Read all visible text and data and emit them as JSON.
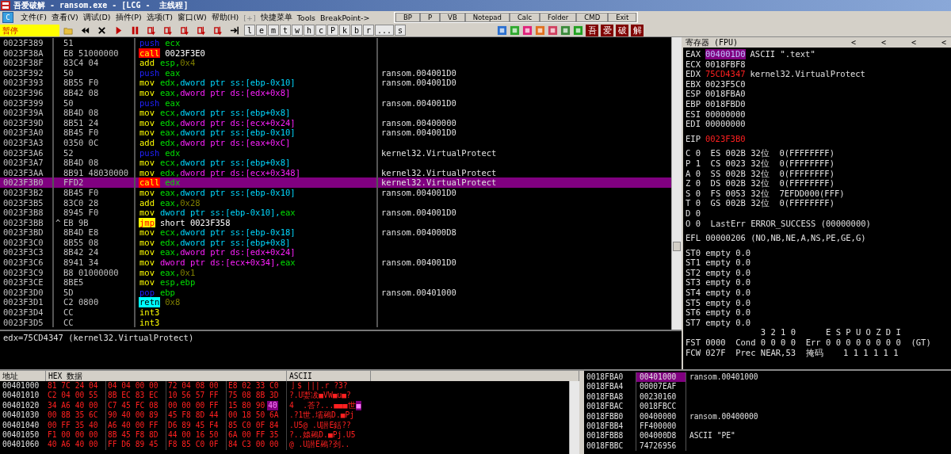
{
  "window": {
    "title": "吾爱破解 - ransom.exe - [LCG -  主线程]"
  },
  "menu": {
    "logo": "C",
    "items": [
      {
        "label": "文件(F)",
        "disabled": false
      },
      {
        "label": "查看(V)",
        "disabled": false
      },
      {
        "label": "调试(D)",
        "disabled": false
      },
      {
        "label": "插件(P)",
        "disabled": false
      },
      {
        "label": "选项(T)",
        "disabled": false
      },
      {
        "label": "窗口(W)",
        "disabled": false
      },
      {
        "label": "帮助(H)",
        "disabled": false
      },
      {
        "label": "[+]",
        "disabled": true
      },
      {
        "label": "快捷菜单",
        "disabled": false
      },
      {
        "label": "Tools",
        "disabled": false
      },
      {
        "label": "BreakPoint->",
        "disabled": false
      }
    ]
  },
  "quick_buttons": [
    "BP",
    "P",
    "VB",
    "Notepad",
    "Calc",
    "Folder",
    "CMD",
    "Exit"
  ],
  "toolbar": {
    "status": "暂停",
    "letter_buttons": [
      "l",
      "e",
      "m",
      "t",
      "w",
      "h",
      "c",
      "P",
      "k",
      "b",
      "r",
      "...",
      "s"
    ],
    "logo_buttons": [
      "吾",
      "爱",
      "破",
      "解"
    ]
  },
  "disasm": {
    "rows": [
      {
        "addr": "0023F389",
        "hex": "51",
        "kind": "stack",
        "mnem": "push",
        "ops": [
          {
            "text": "ecx",
            "kind": "reg"
          }
        ],
        "selected": false
      },
      {
        "addr": "0023F38A",
        "hex": "E8 51000000",
        "kind": "call",
        "mnem": "call",
        "ops": [
          {
            "text": "0023F3E0",
            "kind": "addr"
          }
        ],
        "selected": false
      },
      {
        "addr": "0023F38F",
        "hex": "83C4 04",
        "kind": "plain",
        "mnem": "add",
        "ops": [
          {
            "text": "esp,",
            "kind": "reg"
          },
          {
            "text": "0x4",
            "kind": "imm"
          }
        ],
        "selected": false
      },
      {
        "addr": "0023F392",
        "hex": "50",
        "kind": "stack",
        "mnem": "push",
        "ops": [
          {
            "text": "eax",
            "kind": "reg"
          }
        ],
        "comment": "ransom.004001D0",
        "selected": false
      },
      {
        "addr": "0023F393",
        "hex": "8B55 F0",
        "kind": "plain",
        "mnem": "mov",
        "ops": [
          {
            "text": "edx,",
            "kind": "reg"
          },
          {
            "text": "dword ptr ss:[ebp-0x10]",
            "kind": "ss"
          }
        ],
        "comment": "ransom.004001D0",
        "selected": false
      },
      {
        "addr": "0023F396",
        "hex": "8B42 08",
        "kind": "plain",
        "mnem": "mov",
        "ops": [
          {
            "text": "eax,",
            "kind": "reg"
          },
          {
            "text": "dword ptr ds:[edx+0x8]",
            "kind": "ds"
          }
        ],
        "selected": false
      },
      {
        "addr": "0023F399",
        "hex": "50",
        "kind": "stack",
        "mnem": "push",
        "ops": [
          {
            "text": "eax",
            "kind": "reg"
          }
        ],
        "comment": "ransom.004001D0",
        "selected": false
      },
      {
        "addr": "0023F39A",
        "hex": "8B4D 08",
        "kind": "plain",
        "mnem": "mov",
        "ops": [
          {
            "text": "ecx,",
            "kind": "reg"
          },
          {
            "text": "dword ptr ss:[ebp+0x8]",
            "kind": "ss"
          }
        ],
        "selected": false
      },
      {
        "addr": "0023F39D",
        "hex": "8B51 24",
        "kind": "plain",
        "mnem": "mov",
        "ops": [
          {
            "text": "edx,",
            "kind": "reg"
          },
          {
            "text": "dword ptr ds:[ecx+0x24]",
            "kind": "ds"
          }
        ],
        "comment": "ransom.00400000",
        "selected": false
      },
      {
        "addr": "0023F3A0",
        "hex": "8B45 F0",
        "kind": "plain",
        "mnem": "mov",
        "ops": [
          {
            "text": "eax,",
            "kind": "reg"
          },
          {
            "text": "dword ptr ss:[ebp-0x10]",
            "kind": "ss"
          }
        ],
        "comment": "ransom.004001D0",
        "selected": false
      },
      {
        "addr": "0023F3A3",
        "hex": "0350 0C",
        "kind": "plain",
        "mnem": "add",
        "ops": [
          {
            "text": "edx,",
            "kind": "reg"
          },
          {
            "text": "dword ptr ds:[eax+0xC]",
            "kind": "ds"
          }
        ],
        "selected": false
      },
      {
        "addr": "0023F3A6",
        "hex": "52",
        "kind": "stack",
        "mnem": "push",
        "ops": [
          {
            "text": "edx",
            "kind": "reg"
          }
        ],
        "comment": "kernel32.VirtualProtect",
        "selected": false
      },
      {
        "addr": "0023F3A7",
        "hex": "8B4D 08",
        "kind": "plain",
        "mnem": "mov",
        "ops": [
          {
            "text": "ecx,",
            "kind": "reg"
          },
          {
            "text": "dword ptr ss:[ebp+0x8]",
            "kind": "ss"
          }
        ],
        "selected": false
      },
      {
        "addr": "0023F3AA",
        "hex": "8B91 48030000",
        "kind": "plain",
        "mnem": "mov",
        "ops": [
          {
            "text": "edx,",
            "kind": "reg"
          },
          {
            "text": "dword ptr ds:[ecx+0x348]",
            "kind": "ds"
          }
        ],
        "comment": "kernel32.VirtualProtect",
        "selected": false
      },
      {
        "addr": "0023F3B0",
        "hex": "FFD2",
        "kind": "call",
        "mnem": "call",
        "ops": [
          {
            "text": "edx",
            "kind": "reg"
          }
        ],
        "comment": "kernel32.VirtualProtect",
        "selected": true
      },
      {
        "addr": "0023F3B2",
        "hex": "8B45 F0",
        "kind": "plain",
        "mnem": "mov",
        "ops": [
          {
            "text": "eax,",
            "kind": "reg"
          },
          {
            "text": "dword ptr ss:[ebp-0x10]",
            "kind": "ss"
          }
        ],
        "comment": "ransom.004001D0",
        "selected": false
      },
      {
        "addr": "0023F3B5",
        "hex": "83C0 28",
        "kind": "plain",
        "mnem": "add",
        "ops": [
          {
            "text": "eax,",
            "kind": "reg"
          },
          {
            "text": "0x28",
            "kind": "imm"
          }
        ],
        "selected": false
      },
      {
        "addr": "0023F3B8",
        "hex": "8945 F0",
        "kind": "plain",
        "mnem": "mov",
        "ops": [
          {
            "text": "dword ptr ss:[ebp-0x10],",
            "kind": "ss"
          },
          {
            "text": "eax",
            "kind": "reg"
          }
        ],
        "comment": "ransom.004001D0",
        "selected": false
      },
      {
        "addr": "0023F3BB",
        "jump_mark": "^",
        "hex": "EB 9B",
        "kind": "jump",
        "mnem": "jmp",
        "ops": [
          {
            "text": "short 0023F358",
            "kind": "addr"
          }
        ],
        "selected": false
      },
      {
        "addr": "0023F3BD",
        "hex": "8B4D E8",
        "kind": "plain",
        "mnem": "mov",
        "ops": [
          {
            "text": "ecx,",
            "kind": "reg"
          },
          {
            "text": "dword ptr ss:[ebp-0x18]",
            "kind": "ss"
          }
        ],
        "comment": "ransom.004000D8",
        "selected": false
      },
      {
        "addr": "0023F3C0",
        "hex": "8B55 08",
        "kind": "plain",
        "mnem": "mov",
        "ops": [
          {
            "text": "edx,",
            "kind": "reg"
          },
          {
            "text": "dword ptr ss:[ebp+0x8]",
            "kind": "ss"
          }
        ],
        "selected": false
      },
      {
        "addr": "0023F3C3",
        "hex": "8B42 24",
        "kind": "plain",
        "mnem": "mov",
        "ops": [
          {
            "text": "eax,",
            "kind": "reg"
          },
          {
            "text": "dword ptr ds:[edx+0x24]",
            "kind": "ds"
          }
        ],
        "selected": false
      },
      {
        "addr": "0023F3C6",
        "hex": "8941 34",
        "kind": "plain",
        "mnem": "mov",
        "ops": [
          {
            "text": "dword ptr ds:[ecx+0x34],",
            "kind": "ds"
          },
          {
            "text": "eax",
            "kind": "reg"
          }
        ],
        "comment": "ransom.004001D0",
        "selected": false
      },
      {
        "addr": "0023F3C9",
        "hex": "B8 01000000",
        "kind": "plain",
        "mnem": "mov",
        "ops": [
          {
            "text": "eax,",
            "kind": "reg"
          },
          {
            "text": "0x1",
            "kind": "imm"
          }
        ],
        "selected": false
      },
      {
        "addr": "0023F3CE",
        "hex": "8BE5",
        "kind": "plain",
        "mnem": "mov",
        "ops": [
          {
            "text": "esp,",
            "kind": "reg"
          },
          {
            "text": "ebp",
            "kind": "reg"
          }
        ],
        "selected": false
      },
      {
        "addr": "0023F3D0",
        "hex": "5D",
        "kind": "stack",
        "mnem": "pop",
        "ops": [
          {
            "text": "ebp",
            "kind": "reg"
          }
        ],
        "comment": "ransom.00401000",
        "selected": false
      },
      {
        "addr": "0023F3D1",
        "hex": "C2 0800",
        "kind": "return",
        "mnem": "retn",
        "ops": [
          {
            "text": "0x8",
            "kind": "imm"
          }
        ],
        "selected": false
      },
      {
        "addr": "0023F3D4",
        "hex": "CC",
        "kind": "plain",
        "mnem": "int3",
        "ops": [],
        "selected": false
      },
      {
        "addr": "0023F3D5",
        "hex": "CC",
        "kind": "plain",
        "mnem": "int3",
        "ops": [],
        "selected": false
      }
    ],
    "info": "edx=75CD4347 (kernel32.VirtualProtect)"
  },
  "registers": {
    "title": "寄存器 (FPU)",
    "arrows": [
      "<",
      "<",
      "<",
      "<"
    ],
    "general": [
      {
        "name": "EAX",
        "value": "004001D0",
        "selected": true,
        "changed": false,
        "note": "ASCII \".text\""
      },
      {
        "name": "ECX",
        "value": "0018FBF8",
        "selected": false,
        "changed": false
      },
      {
        "name": "EDX",
        "value": "75CD4347",
        "selected": false,
        "changed": true,
        "note": "kernel32.VirtualProtect"
      },
      {
        "name": "EBX",
        "value": "0023F5C0",
        "selected": false,
        "changed": false
      },
      {
        "name": "ESP",
        "value": "0018FBA0",
        "selected": false,
        "changed": false
      },
      {
        "name": "EBP",
        "value": "0018FBD0",
        "selected": false,
        "changed": false
      },
      {
        "name": "ESI",
        "value": "00000000",
        "selected": false,
        "changed": false
      },
      {
        "name": "EDI",
        "value": "00000000",
        "selected": false,
        "changed": false
      }
    ],
    "eip": {
      "name": "EIP",
      "value": "0023F3B0",
      "selected": false,
      "changed": true
    },
    "groups": [
      [
        "C 0  ES 002B 32位  0(FFFFFFFF)",
        "P 1  CS 0023 32位  0(FFFFFFFF)",
        "A 0  SS 002B 32位  0(FFFFFFFF)",
        "Z 0  DS 002B 32位  0(FFFFFFFF)",
        "S 0  FS 0053 32位  7EFDD000(FFF)",
        "T 0  GS 002B 32位  0(FFFFFFFF)",
        "D 0",
        "O 0  LastErr ERROR_SUCCESS (00000000)"
      ],
      [
        "EFL 00000206 (NO,NB,NE,A,NS,PE,GE,G)"
      ],
      [
        "ST0 empty 0.0",
        "ST1 empty 0.0",
        "ST2 empty 0.0",
        "ST3 empty 0.0",
        "ST4 empty 0.0",
        "ST5 empty 0.0",
        "ST6 empty 0.0",
        "ST7 empty 0.0",
        "               3 2 1 0      E S P U O Z D I",
        "FST 0000  Cond 0 0 0 0  Err 0 0 0 0 0 0 0 0  (GT)",
        "FCW 027F  Prec NEAR,53  掩码    1 1 1 1 1 1"
      ]
    ]
  },
  "dump": {
    "columns": [
      "地址",
      "HEX 数据",
      "ASCII"
    ],
    "rows": [
      {
        "addr": "00401000",
        "hex": [
          "81 7C 24 04",
          "04 04 00 00",
          "72 04 08 00",
          "E8 02 33 C0"
        ],
        "ascii": "亅$ |||.r ?3?"
      },
      {
        "addr": "00401010",
        "hex": [
          "C2 04 00 55",
          "8B EC 83 EC",
          "10 56 57 FF",
          "75 08 8B 3D"
        ],
        "ascii": "?.U嬱冹■VW■u■?"
      },
      {
        "addr": "00401020",
        "hex": [
          "34 A6 40 00",
          "C7 45 FC 08",
          "00 00 00 FF",
          "15 80 90"
        ],
        "marked_byte": "40",
        "ascii": "4  .荅?...■■■世",
        "marked_char": "■"
      },
      {
        "addr": "00401030",
        "hex": [
          "00 8B 35 6C",
          "90 40 00 89",
          "45 F8 8D 44",
          "00 18 50 6A"
        ],
        "ascii": ".?1世.壖鵐D.■Pj"
      },
      {
        "addr": "00401040",
        "hex": [
          "00 FF 35 40",
          "A6 40 00 FF",
          "D6 89 45 F4",
          "85 C0 0F 84"
        ],
        "ascii": ".U5@ .U譛E銛??"
      },
      {
        "addr": "00401050",
        "hex": [
          "F1 00 00 00",
          "8B 45 F8 8D",
          "44 00 16 50",
          "6A 00 FF 35"
        ],
        "ascii": "?..媴鵐D.■Pj.U5"
      },
      {
        "addr": "00401060",
        "hex": [
          "40 A6 40 00",
          "FF D6 89 45",
          "F8 85 C0 0F",
          "84 C3 00 00"
        ],
        "ascii": "@ .U譛E鵐?刭.."
      }
    ]
  },
  "stack": {
    "rows": [
      {
        "addr": "0018FBA0",
        "value": "00401000",
        "comment": "ransom.00401000",
        "selected": true
      },
      {
        "addr": "0018FBA4",
        "value": "00007EAF",
        "selected": false
      },
      {
        "addr": "0018FBA8",
        "value": "00230160",
        "selected": false
      },
      {
        "addr": "0018FBAC",
        "value": "0018FBCC",
        "selected": false
      },
      {
        "addr": "0018FBB0",
        "value": "00400000",
        "comment": "ransom.00400000",
        "selected": false
      },
      {
        "addr": "0018FBB4",
        "value": "FF400000",
        "selected": false
      },
      {
        "addr": "0018FBB8",
        "value": "004000D8",
        "comment": "ASCII \"PE\"",
        "selected": false
      },
      {
        "addr": "0018FBBC",
        "value": "74726956",
        "selected": false
      }
    ]
  }
}
